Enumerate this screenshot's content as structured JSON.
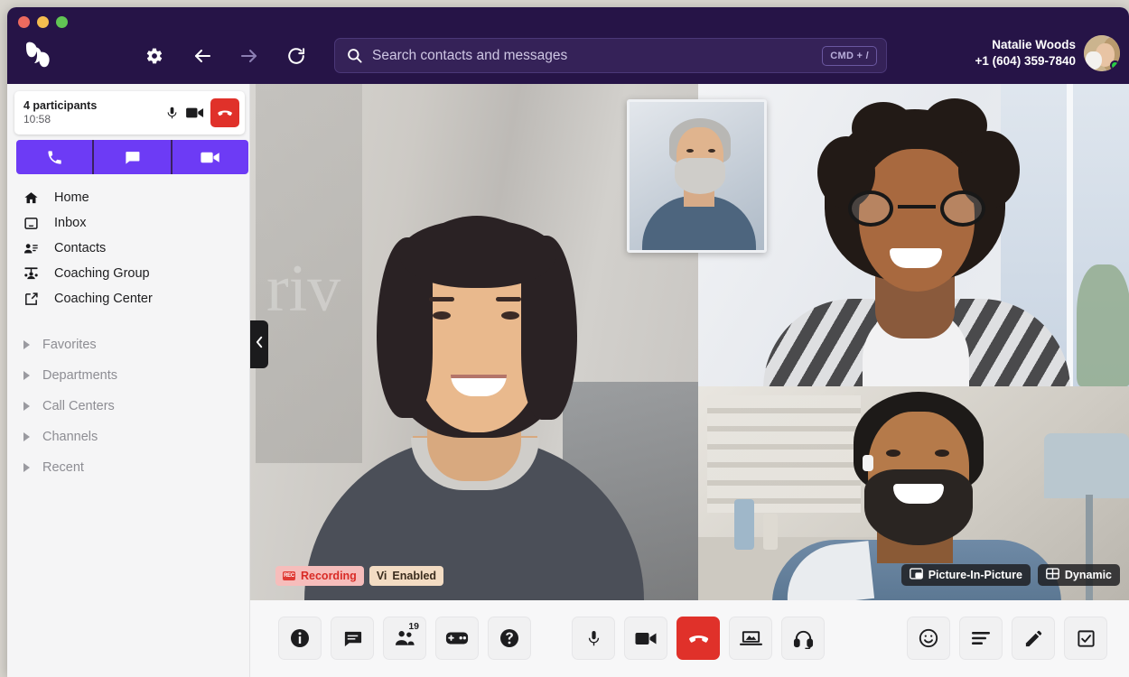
{
  "window": {
    "traffic_lights": [
      "close",
      "minimize",
      "maximize"
    ],
    "logo_name": "app-logo"
  },
  "header": {
    "nav": [
      {
        "name": "settings-button",
        "icon": "gear-icon"
      },
      {
        "name": "back-button",
        "icon": "arrow-left-icon"
      },
      {
        "name": "forward-button",
        "icon": "arrow-right-icon"
      },
      {
        "name": "reload-button",
        "icon": "reload-icon"
      }
    ],
    "search": {
      "placeholder": "Search contacts and messages",
      "shortcut": "CMD + /",
      "icon": "search-icon"
    },
    "user": {
      "name": "Natalie Woods",
      "phone": "+1 (604) 359-7840",
      "status": "online"
    }
  },
  "sidebar": {
    "call_card": {
      "participants": "4 participants",
      "duration": "10:58",
      "mic_icon": "microphone-icon",
      "video_icon": "video-camera-icon",
      "end_icon": "phone-hangup-icon"
    },
    "quick_actions": [
      {
        "name": "new-call-button",
        "icon": "phone-icon"
      },
      {
        "name": "new-message-button",
        "icon": "chat-icon"
      },
      {
        "name": "new-video-button",
        "icon": "video-camera-icon"
      }
    ],
    "nav_items": [
      {
        "label": "Home",
        "icon": "home-icon"
      },
      {
        "label": "Inbox",
        "icon": "inbox-icon"
      },
      {
        "label": "Contacts",
        "icon": "contacts-icon"
      },
      {
        "label": "Coaching Group",
        "icon": "group-icon"
      },
      {
        "label": "Coaching Center",
        "icon": "external-link-icon"
      }
    ],
    "sections": [
      {
        "label": "Favorites"
      },
      {
        "label": "Departments"
      },
      {
        "label": "Call Centers"
      },
      {
        "label": "Channels"
      },
      {
        "label": "Recent"
      }
    ]
  },
  "stage": {
    "collapse_icon": "chevron-left-icon",
    "badges": [
      {
        "label": "Recording",
        "tag": "REC",
        "type": "recording"
      },
      {
        "label": "Enabled",
        "tag": "Vi",
        "type": "vi"
      }
    ],
    "overlay_badges": [
      {
        "label": "Picture-In-Picture",
        "icon": "picture-in-picture-icon"
      },
      {
        "label": "Dynamic",
        "icon": "grid-layout-icon"
      }
    ]
  },
  "toolbar": {
    "left": [
      {
        "name": "info-button",
        "icon": "info-icon",
        "badge": ""
      },
      {
        "name": "chat-button",
        "icon": "chat-icon",
        "badge": ""
      },
      {
        "name": "participants-button",
        "icon": "participants-icon",
        "badge": "19"
      },
      {
        "name": "game-button",
        "icon": "game-controller-icon",
        "badge": ""
      },
      {
        "name": "help-button",
        "icon": "help-icon",
        "badge": ""
      }
    ],
    "center": [
      {
        "name": "mute-button",
        "icon": "microphone-icon",
        "danger": false
      },
      {
        "name": "camera-button",
        "icon": "video-camera-icon",
        "danger": false
      },
      {
        "name": "end-call-button",
        "icon": "phone-hangup-icon",
        "danger": true
      },
      {
        "name": "share-screen-button",
        "icon": "screen-share-icon",
        "danger": false
      },
      {
        "name": "audio-device-button",
        "icon": "headset-icon",
        "danger": false
      }
    ],
    "right": [
      {
        "name": "reactions-button",
        "icon": "emoji-icon"
      },
      {
        "name": "transcript-button",
        "icon": "list-icon"
      },
      {
        "name": "annotate-button",
        "icon": "pencil-icon"
      },
      {
        "name": "tasks-button",
        "icon": "checkbox-icon"
      }
    ]
  },
  "colors": {
    "header_bg": "#261447",
    "accent_purple": "#6d3bf5",
    "danger_red": "#e0312a",
    "online_green": "#27d045"
  }
}
